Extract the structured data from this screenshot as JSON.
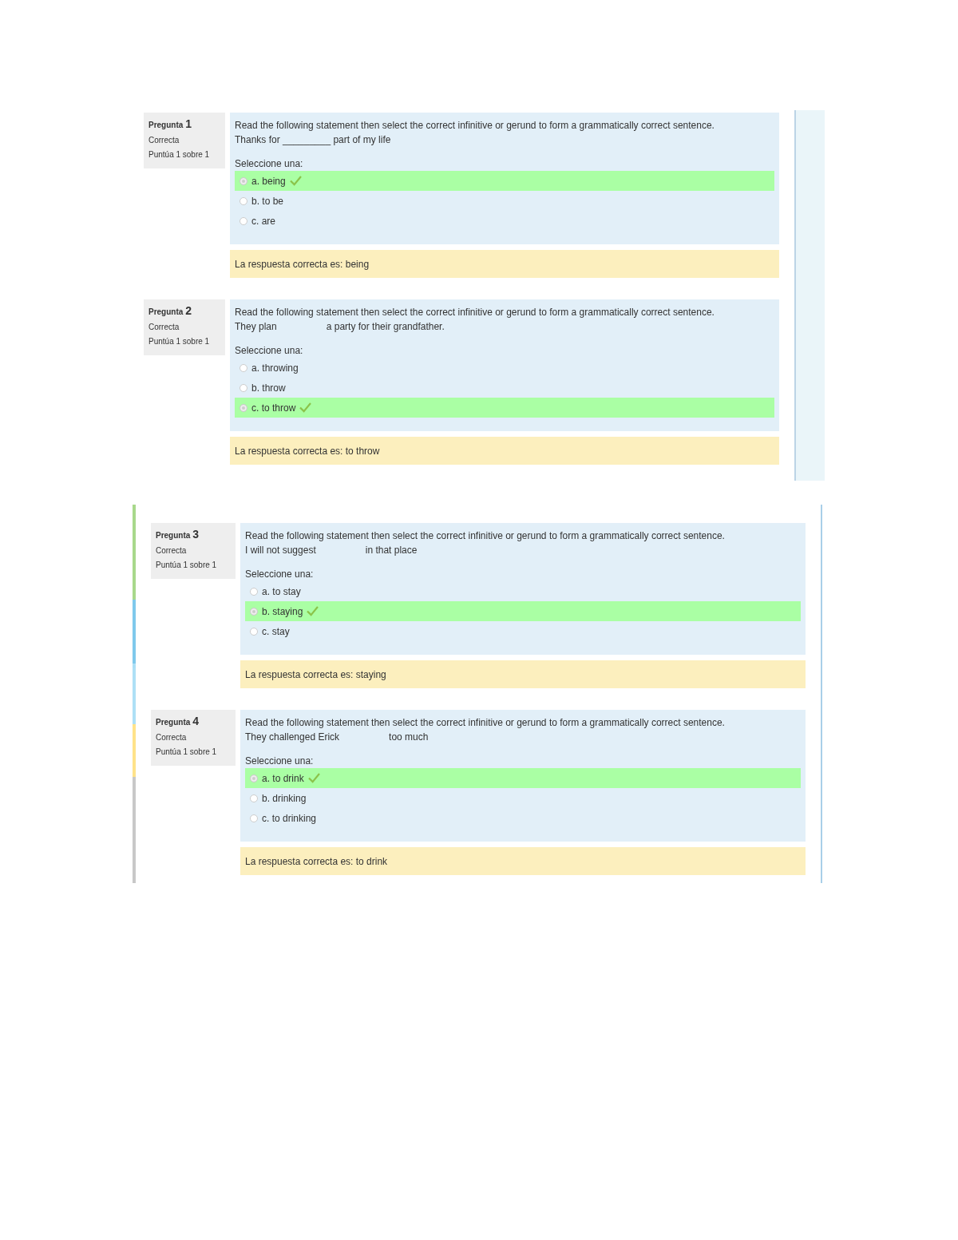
{
  "panels": [
    {
      "questions": [
        {
          "label": "Pregunta",
          "number": "1",
          "status": "Correcta",
          "score": "Puntúa 1 sobre 1",
          "prompt": "Read the following statement then select the correct infinitive or gerund to form a grammatically correct sentence.",
          "sentence": [
            "Thanks for _________ part of my life"
          ],
          "select_label": "Seleccione una:",
          "options": [
            {
              "text": "a. being",
              "selected": true
            },
            {
              "text": "b. to be",
              "selected": false
            },
            {
              "text": "c. are",
              "selected": false
            }
          ],
          "feedback": "La respuesta correcta es: being"
        },
        {
          "label": "Pregunta",
          "number": "2",
          "status": "Correcta",
          "score": "Puntúa 1 sobre 1",
          "prompt": "Read the following statement then select the correct infinitive or gerund to form a grammatically correct sentence.",
          "sentence": [
            "They plan",
            "a party for their grandfather."
          ],
          "select_label": "Seleccione una:",
          "options": [
            {
              "text": "a. throwing",
              "selected": false
            },
            {
              "text": "b. throw",
              "selected": false
            },
            {
              "text": "c. to throw",
              "selected": true
            }
          ],
          "feedback": "La respuesta correcta es: to throw"
        }
      ]
    },
    {
      "questions": [
        {
          "label": "Pregunta",
          "number": "3",
          "status": "Correcta",
          "score": "Puntúa 1 sobre 1",
          "prompt": "Read the following statement then select the correct infinitive or gerund to form a grammatically correct sentence.",
          "sentence": [
            "I will not suggest",
            "in that place"
          ],
          "select_label": "Seleccione una:",
          "options": [
            {
              "text": "a. to stay",
              "selected": false
            },
            {
              "text": "b. staying",
              "selected": true
            },
            {
              "text": "c. stay",
              "selected": false
            }
          ],
          "feedback": "La respuesta correcta es: staying"
        },
        {
          "label": "Pregunta",
          "number": "4",
          "status": "Correcta",
          "score": "Puntúa 1 sobre 1",
          "prompt": "Read the following statement then select the correct infinitive or gerund to form a grammatically correct sentence.",
          "sentence": [
            "They challenged Erick",
            "too much"
          ],
          "select_label": "Seleccione una:",
          "options": [
            {
              "text": "a. to drink",
              "selected": true
            },
            {
              "text": "b. drinking",
              "selected": false
            },
            {
              "text": "c. to drinking",
              "selected": false
            }
          ],
          "feedback": "La respuesta correcta es: to drink"
        }
      ]
    }
  ]
}
